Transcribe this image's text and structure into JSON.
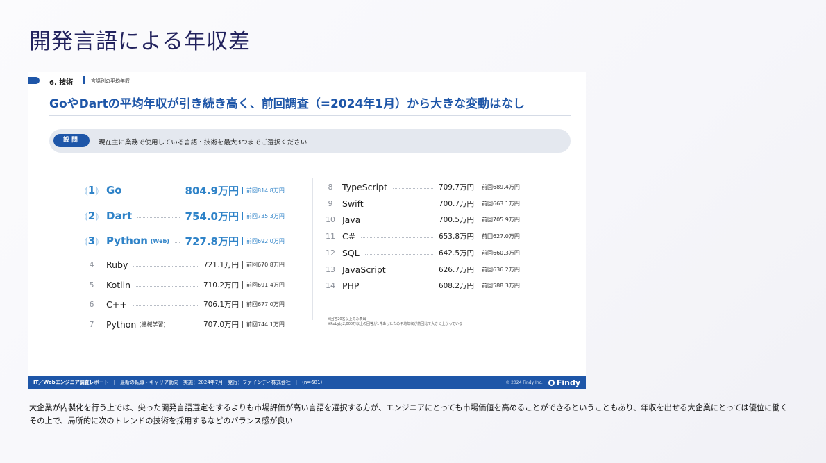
{
  "page_title": "開発言語による年収差",
  "slide": {
    "section_label": "6. 技術",
    "section_sub": "言語別の平均年収",
    "headline": "GoやDartの平均年収が引き続き高く、前回調査（=2024年1月）から大きな変動はなし",
    "question_badge": "設問",
    "question_text": "現在主に業務で使用している言語・技術を最大3つまでご選択ください",
    "top_ranks": [
      {
        "rank": "1",
        "lang": "Go",
        "note": "",
        "value": "804.9万円",
        "prev": "前回814.8万円"
      },
      {
        "rank": "2",
        "lang": "Dart",
        "note": "",
        "value": "754.0万円",
        "prev": "前回735.3万円"
      },
      {
        "rank": "3",
        "lang": "Python",
        "note": "(Web)",
        "value": "727.8万円",
        "prev": "前回692.0万円"
      }
    ],
    "left_ranks": [
      {
        "rank": "4",
        "lang": "Ruby",
        "note": "",
        "value": "721.1万円",
        "prev": "前回670.8万円"
      },
      {
        "rank": "5",
        "lang": "Kotlin",
        "note": "",
        "value": "710.2万円",
        "prev": "前回691.4万円"
      },
      {
        "rank": "6",
        "lang": "C++",
        "note": "",
        "value": "706.1万円",
        "prev": "前回677.0万円"
      },
      {
        "rank": "7",
        "lang": "Python",
        "note": "(機械学習)",
        "value": "707.0万円",
        "prev": "前回744.1万円"
      }
    ],
    "right_ranks": [
      {
        "rank": "8",
        "lang": "TypeScript",
        "value": "709.7万円",
        "prev": "前回689.4万円"
      },
      {
        "rank": "9",
        "lang": "Swift",
        "value": "700.7万円",
        "prev": "前回663.1万円"
      },
      {
        "rank": "10",
        "lang": "Java",
        "value": "700.5万円",
        "prev": "前回705.9万円"
      },
      {
        "rank": "11",
        "lang": "C#",
        "value": "653.8万円",
        "prev": "前回627.0万円"
      },
      {
        "rank": "12",
        "lang": "SQL",
        "value": "642.5万円",
        "prev": "前回660.3万円"
      },
      {
        "rank": "13",
        "lang": "JavaScript",
        "value": "626.7万円",
        "prev": "前回636.2万円"
      },
      {
        "rank": "14",
        "lang": "PHP",
        "value": "608.2万円",
        "prev": "前回588.3万円"
      }
    ],
    "notes": [
      "※回答20名以上のみ表出",
      "※Rubyは2,000万以上の回答が1件あったため平均年収が前回比で大きく上がっている"
    ],
    "footer": {
      "report": "IT／Webエンジニア調査レポート",
      "subtitle": "最新の転職・キャリア動向",
      "conducted": "実施：2024年7月",
      "publisher": "発行：ファインディ株式会社",
      "n": "(n=681)",
      "copyright": "© 2024 Findy Inc.",
      "logo": "Findy"
    }
  },
  "body_text": {
    "line1": "大企業が内製化を行う上では、尖った開発言語選定をするよりも市場評価が高い言語を選択する方が、エンジニアにとっても市場価値を高めることができるということもあり、年収を出せる大企業にとっては優位に働く",
    "line2": "その上で、局所的に次のトレンドの技術を採用するなどのバランス感が良い"
  }
}
